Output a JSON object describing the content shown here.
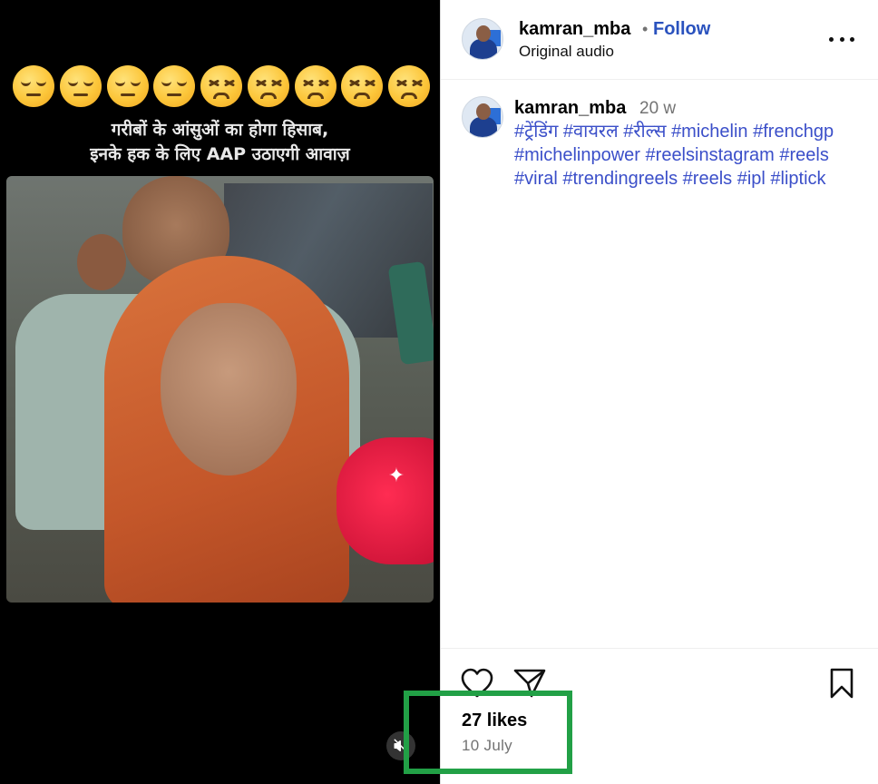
{
  "media": {
    "emojis": [
      "pensive",
      "pensive",
      "pensive",
      "pensive",
      "tired",
      "tired",
      "tired",
      "tired",
      "tired"
    ],
    "caption_line1": "गरीबों के आंसुओं का होगा हिसाब,",
    "caption_line2": "इनके हक के लिए AAP उठाएगी आवाज़",
    "mute_icon": "speaker-muted-icon"
  },
  "header": {
    "username": "kamran_mba",
    "separator": "•",
    "follow_label": "Follow",
    "audio_label": "Original audio"
  },
  "comment": {
    "username": "kamran_mba",
    "age": "20 w",
    "hashtags": [
      "#ट्रेंडिंग",
      "#वायरल",
      "#रील्स",
      "#michelin",
      "#frenchgp",
      "#michelinpower",
      "#reelsinstagram",
      "#reels",
      "#viral",
      "#trendingreels",
      "#reels",
      "#ipl",
      "#liptick"
    ]
  },
  "footer": {
    "likes": "27 likes",
    "date": "10 July"
  },
  "colors": {
    "follow": "#2a52be",
    "hashtag": "#3b4fc9",
    "highlight": "#22a046"
  }
}
